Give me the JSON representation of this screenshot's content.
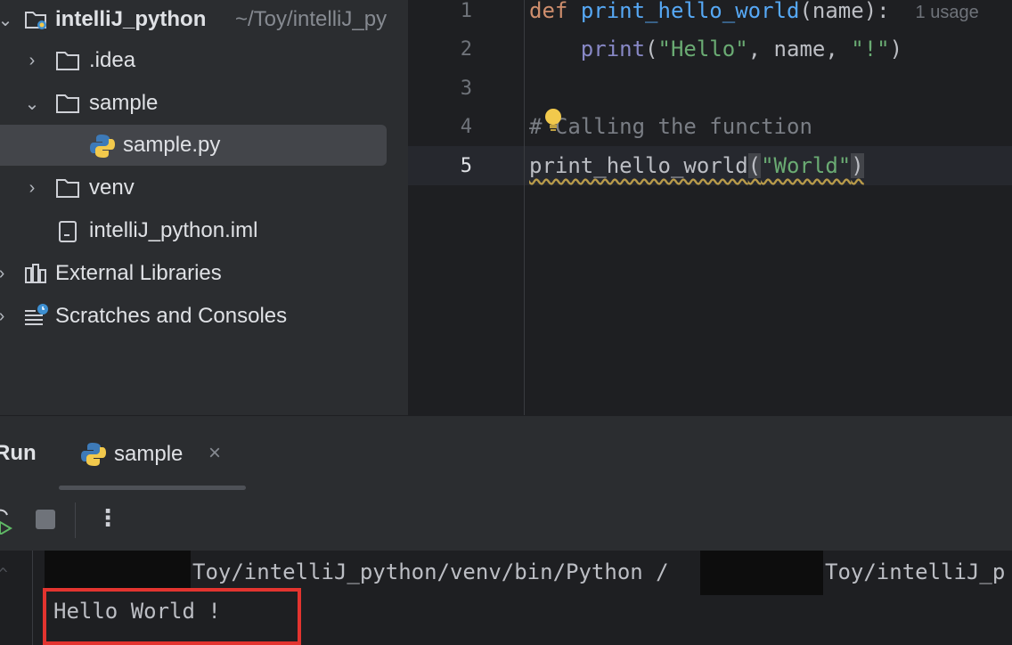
{
  "project_tree": {
    "root": {
      "name": "intelliJ_python",
      "path": "~/Toy/intelliJ_py"
    },
    "items": [
      {
        "label": ".idea",
        "type": "folder",
        "expanded": false
      },
      {
        "label": "sample",
        "type": "folder",
        "expanded": true
      },
      {
        "label": "sample.py",
        "type": "python-file",
        "selected": true
      },
      {
        "label": "venv",
        "type": "folder",
        "expanded": false
      },
      {
        "label": "intelliJ_python.iml",
        "type": "module-file"
      },
      {
        "label": "External Libraries",
        "type": "libraries"
      },
      {
        "label": "Scratches and Consoles",
        "type": "scratches"
      }
    ]
  },
  "editor": {
    "line_numbers": [
      "1",
      "2",
      "3",
      "4",
      "5"
    ],
    "current_line": "5",
    "lines": {
      "l1": {
        "kw": "def",
        "fn": "print_hello_world",
        "rest": "(name):",
        "hint": "1 usage"
      },
      "l2": {
        "fn": "print",
        "open": "(",
        "s1": "\"Hello\"",
        "mid": ", name, ",
        "s2": "\"!\"",
        "close": ")"
      },
      "l4": {
        "hash": "#",
        "text": "Calling the function"
      },
      "l5": {
        "fn": "print_hello_world",
        "open": "(",
        "arg": "\"World\"",
        "close": ")"
      }
    }
  },
  "run_panel": {
    "title": "Run",
    "tab_label": "sample",
    "console": {
      "command_part1": "Toy/intelliJ_python/venv/bin/Python /",
      "command_part2": "Toy/intelliJ_p",
      "output": "Hello World !"
    }
  },
  "colors": {
    "highlight_box": "#e3342f",
    "keyword": "#cf8e6d",
    "function": "#56a8f5",
    "string": "#6aab73"
  }
}
